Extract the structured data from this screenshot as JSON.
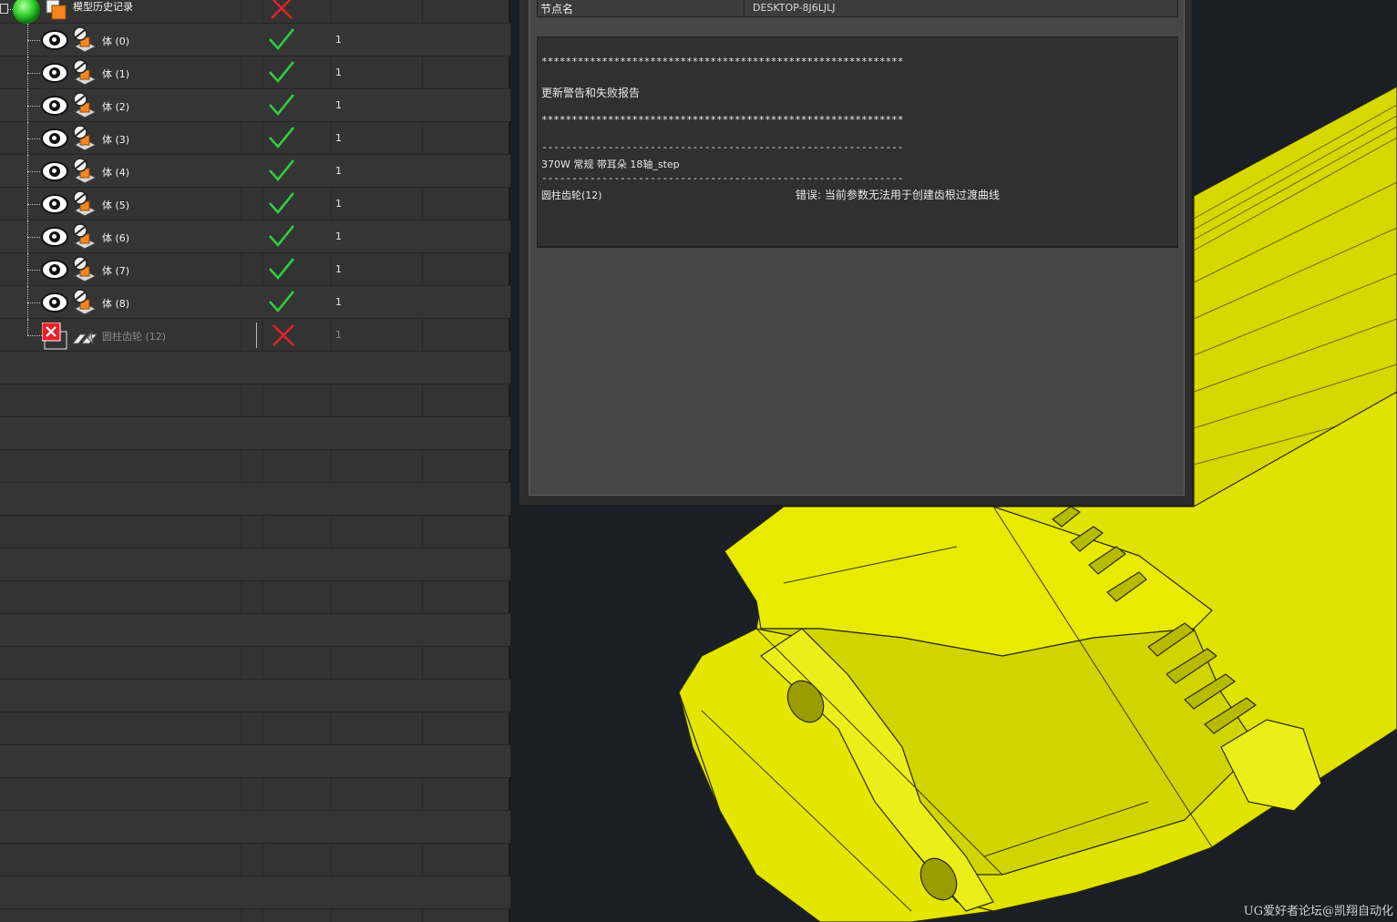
{
  "navigator": {
    "root": {
      "label": "模型历史记录",
      "status": "error"
    },
    "rows": [
      {
        "label": "体 (0)",
        "status": "ok",
        "count": "1"
      },
      {
        "label": "体 (1)",
        "status": "ok",
        "count": "1"
      },
      {
        "label": "体 (2)",
        "status": "ok",
        "count": "1"
      },
      {
        "label": "体 (3)",
        "status": "ok",
        "count": "1"
      },
      {
        "label": "体 (4)",
        "status": "ok",
        "count": "1"
      },
      {
        "label": "体 (5)",
        "status": "ok",
        "count": "1"
      },
      {
        "label": "体 (6)",
        "status": "ok",
        "count": "1"
      },
      {
        "label": "体 (7)",
        "status": "ok",
        "count": "1"
      },
      {
        "label": "体 (8)",
        "status": "ok",
        "count": "1"
      },
      {
        "label": "圆柱齿轮 (12)",
        "status": "error",
        "count": "1"
      }
    ]
  },
  "dialog": {
    "node_key": "节点名",
    "node_value": "DESKTOP-8J6LJLJ",
    "log": {
      "stars_1": "************************************************************",
      "heading": "更新警告和失败报告",
      "stars_2": "************************************************************",
      "dashes_1": "------------------------------------------------------------",
      "part_name": "370W 常规 带耳朵 18轴_step",
      "dashes_2": "------------------------------------------------------------",
      "feature": "圆柱齿轮(12)",
      "error": "错误: 当前参数无法用于创建齿根过渡曲线"
    }
  },
  "viewport": {
    "model_color": "#e4e600",
    "background": "#1b1e24"
  },
  "watermark": "UG爱好者论坛@凯翔自动化",
  "colors": {
    "ok": "#2ecc40",
    "error": "#e8202a",
    "panel": "#333333"
  }
}
